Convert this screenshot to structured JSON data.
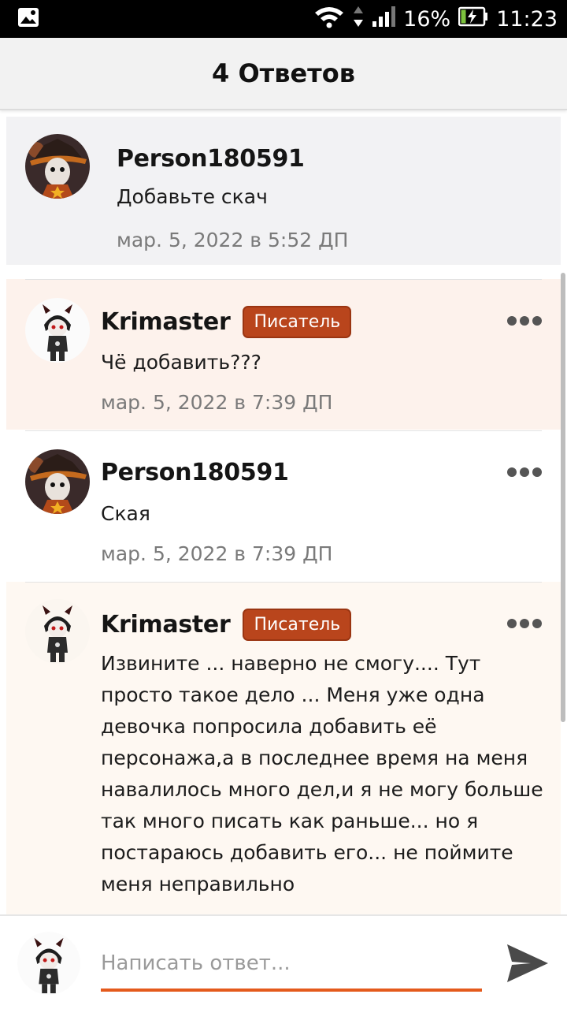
{
  "status_bar": {
    "battery": "16%",
    "time": "11:23",
    "icons": [
      "gallery-icon",
      "wifi-icon",
      "signal-icon",
      "battery-icon"
    ]
  },
  "header": {
    "title": "4 Ответов"
  },
  "comments": [
    {
      "author": "Person180591",
      "badge": "",
      "text": "Добавьте скач",
      "date": "мар. 5, 2022 в 5:52 ДП"
    },
    {
      "author": "Krimaster",
      "badge": "Писатель",
      "text": "Чё добавить???",
      "date": "мар. 5, 2022 в 7:39 ДП"
    },
    {
      "author": "Person180591",
      "badge": "",
      "text": "Ская",
      "date": "мар. 5, 2022 в 7:39 ДП"
    },
    {
      "author": "Krimaster",
      "badge": "Писатель",
      "text_lines": [
        "Извините ... наверно не смогу.... Тут",
        "просто такое дело ... Меня уже одна",
        "девочка попросила добавить её",
        "персонажа,а в последнее время на меня",
        "навалилось много дел,и я не могу больше",
        "так много писать как раньше... но я",
        "постараюсь добавить его... не поймите",
        "меня неправильно"
      ],
      "date": ""
    }
  ],
  "reply": {
    "placeholder": "Написать ответ..."
  },
  "colors": {
    "accent": "#e45a1c",
    "badge": "#b9451c",
    "header_bg": "#f2f2f2"
  }
}
